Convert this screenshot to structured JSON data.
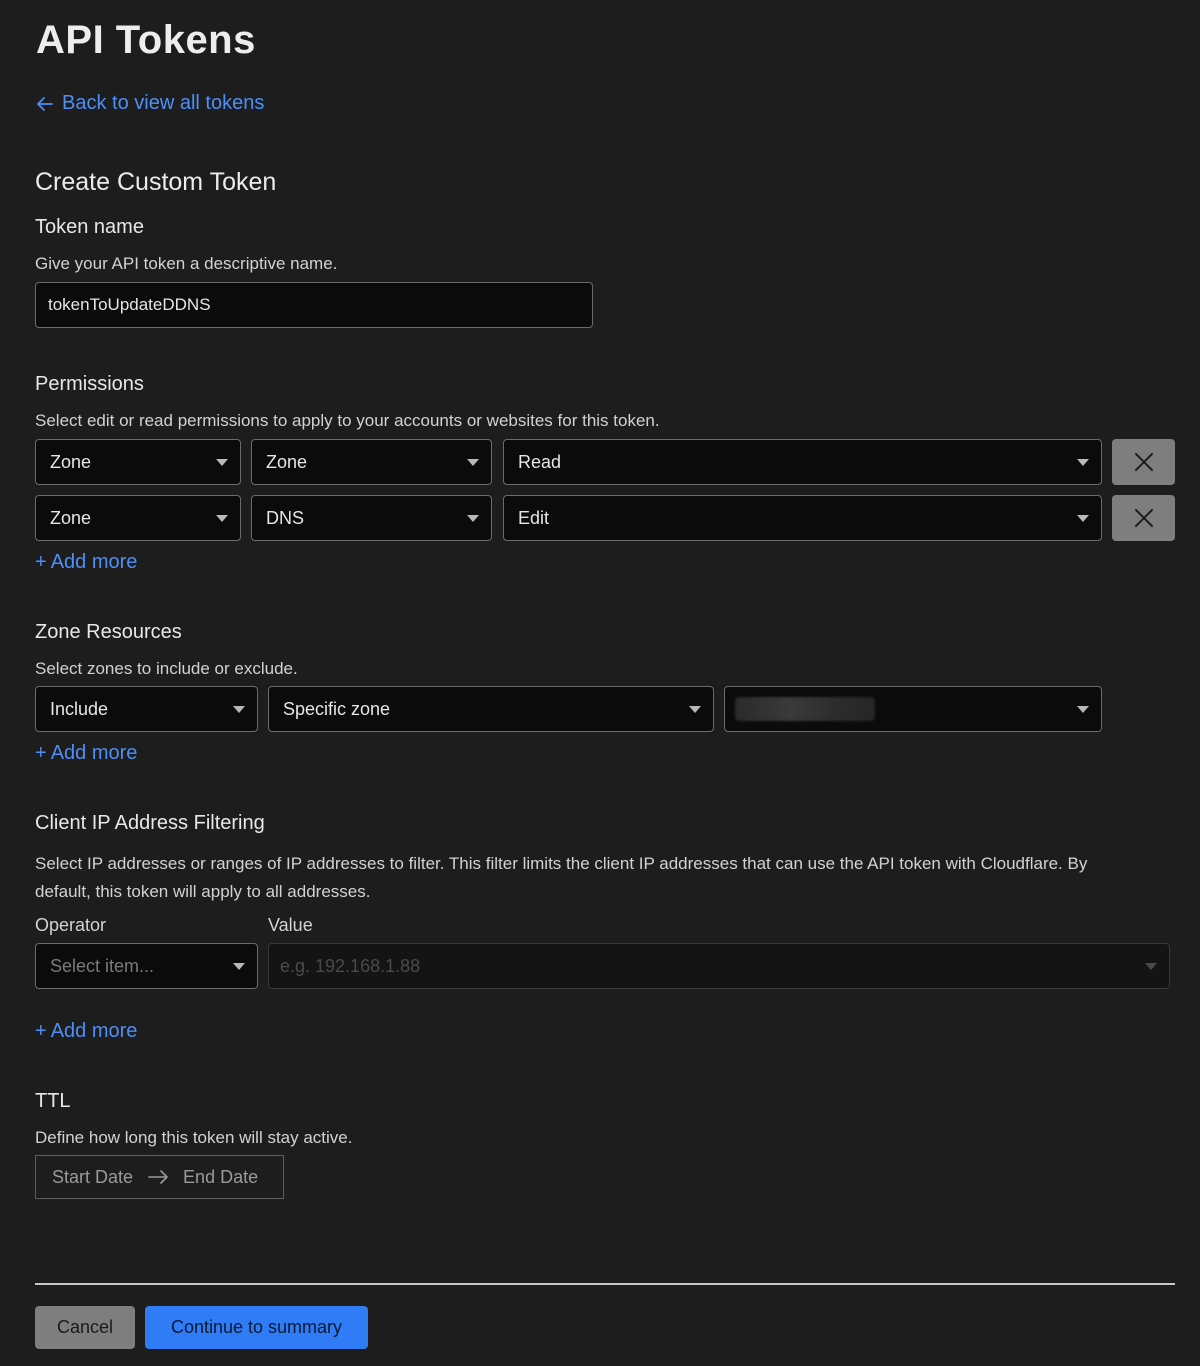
{
  "page": {
    "title": "API Tokens"
  },
  "back_link": {
    "label": "Back to view all tokens",
    "icon": "arrow-left-icon"
  },
  "form": {
    "title": "Create Custom Token",
    "token_name": {
      "label": "Token name",
      "description": "Give your API token a descriptive name.",
      "value": "tokenToUpdateDDNS"
    },
    "permissions": {
      "label": "Permissions",
      "description": "Select edit or read permissions to apply to your accounts or websites for this token.",
      "rows": [
        {
          "scope": "Zone",
          "resource": "Zone",
          "access": "Read"
        },
        {
          "scope": "Zone",
          "resource": "DNS",
          "access": "Edit"
        }
      ],
      "add_more": "Add more"
    },
    "zone_resources": {
      "label": "Zone Resources",
      "description": "Select zones to include or exclude.",
      "rows": [
        {
          "mode": "Include",
          "type": "Specific zone",
          "zone": ""
        }
      ],
      "add_more": "Add more"
    },
    "ip_filtering": {
      "label": "Client IP Address Filtering",
      "description": "Select IP addresses or ranges of IP addresses to filter. This filter limits the client IP addresses that can use the API token with Cloudflare. By default, this token will apply to all addresses.",
      "operator_label": "Operator",
      "value_label": "Value",
      "operator_placeholder": "Select item...",
      "value_placeholder": "e.g. 192.168.1.88",
      "add_more": "Add more"
    },
    "ttl": {
      "label": "TTL",
      "description": "Define how long this token will stay active.",
      "start_placeholder": "Start Date",
      "end_placeholder": "End Date"
    }
  },
  "actions": {
    "cancel": "Cancel",
    "continue": "Continue to summary"
  },
  "colors": {
    "background": "#1d1d1d",
    "link": "#4d8ff7",
    "primary_button": "#2f7cf6",
    "secondary_button": "#7e7e7e"
  }
}
